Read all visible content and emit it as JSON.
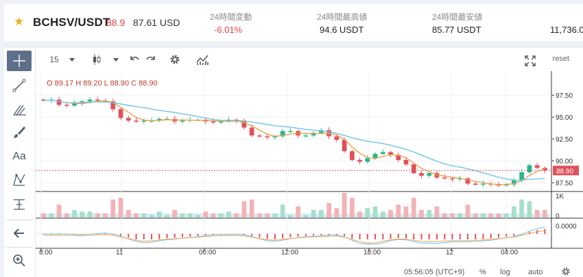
{
  "ticker": {
    "pair": "BCHSV/USDT",
    "last_price": "88.9",
    "fiat_price": "87.61 USD",
    "stats": [
      {
        "label": "24時間変動",
        "value": "-6.01%"
      },
      {
        "label": "24時間最高値",
        "value": "94.6 USDT"
      },
      {
        "label": "24時間最安値",
        "value": "85.77 USDT"
      },
      {
        "label": "",
        "value": "11,736.0"
      }
    ]
  },
  "toolbar": {
    "interval": "15",
    "reset_label": "reset"
  },
  "chart": {
    "ohlc_legend": "O 89.17 H 89.20 L 88.90 C 88.90",
    "price_ticks": [
      "97.50",
      "95.00",
      "92.50",
      "90.00",
      "87.50"
    ],
    "last_price_label": "88.90",
    "volume_tick": "1K",
    "volume_tick_zero": "0",
    "macd_tick": "0.0000",
    "time_ticks": [
      "8:00",
      "11",
      "06:00",
      "12:00",
      "18:00",
      "12",
      "04:00"
    ],
    "clock": "05:56:05 (UTC+9)",
    "bottom_buttons": [
      "%",
      "log",
      "auto"
    ]
  },
  "colors": {
    "up": "#26b68a",
    "down": "#e0505a",
    "ma_fast": "#f0a24c",
    "ma_slow": "#6cc4e8",
    "accent": "#f2b01e"
  },
  "chart_data": {
    "type": "candlestick",
    "price_axis": [
      87.5,
      97.5
    ],
    "close_series": [
      96.9,
      97.0,
      96.4,
      96.3,
      96.6,
      96.8,
      97.0,
      96.9,
      96.8,
      95.9,
      94.9,
      94.6,
      94.5,
      94.6,
      94.6,
      94.8,
      94.8,
      94.5,
      94.6,
      94.7,
      94.7,
      94.5,
      94.4,
      94.5,
      94.7,
      94.6,
      93.8,
      92.9,
      92.8,
      92.7,
      92.8,
      93.4,
      93.4,
      92.9,
      92.9,
      93.2,
      93.5,
      92.8,
      92.4,
      91.1,
      90.1,
      89.9,
      90.3,
      90.8,
      91.0,
      90.7,
      90.1,
      89.6,
      88.6,
      88.3,
      88.6,
      88.1,
      88.0,
      87.9,
      88.0,
      87.4,
      87.3,
      87.4,
      87.3,
      87.2,
      87.3,
      87.8,
      88.7,
      89.5,
      89.2,
      88.9
    ],
    "last": 88.9,
    "series": [
      {
        "name": "O 89.17 H 89.20 L 88.90 C 88.90"
      }
    ]
  }
}
